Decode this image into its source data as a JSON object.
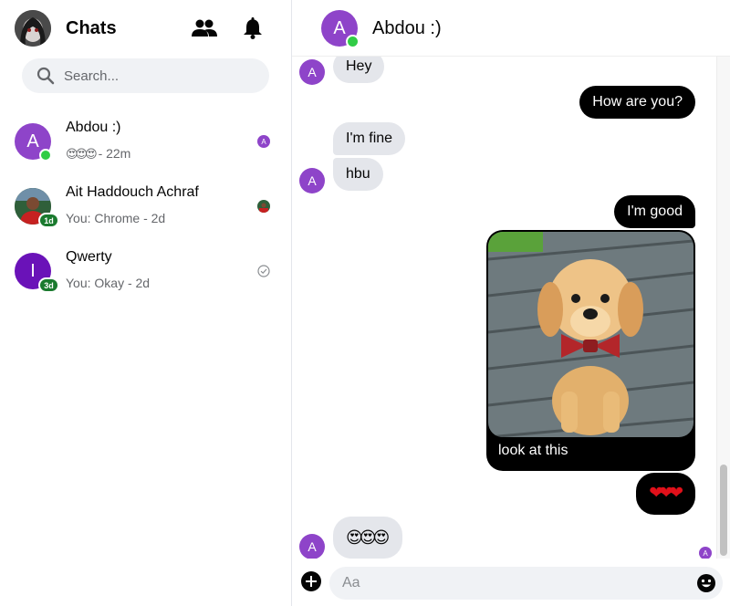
{
  "sidebar": {
    "title": "Chats",
    "search_placeholder": "Search...",
    "chats": [
      {
        "name": "Abdou :)",
        "avatar_letter": "A",
        "sub_emoji": "😍😍😍",
        "sub": "- 22m",
        "avatar_color": "#8e44c9",
        "online": true
      },
      {
        "name": "Ait Haddouch Achraf",
        "avatar_letter": "",
        "sub": "You: Chrome - 2d",
        "badge": "1d"
      },
      {
        "name": "Qwerty",
        "avatar_letter": "I",
        "sub": "You: Okay - 2d",
        "badge": "3d",
        "avatar_color": "#6a12b8"
      }
    ]
  },
  "conversation": {
    "name": "Abdou :)",
    "avatar_letter": "A",
    "messages": [
      {
        "dir": "in",
        "text": "Hey"
      },
      {
        "dir": "out",
        "text": "How are you?"
      },
      {
        "dir": "in",
        "text": "I'm fine"
      },
      {
        "dir": "in",
        "text": "hbu"
      },
      {
        "dir": "out",
        "text": "I'm good"
      },
      {
        "dir": "out",
        "type": "image",
        "caption": "look at this"
      },
      {
        "dir": "out",
        "text": "❤❤❤"
      },
      {
        "dir": "in",
        "text": "😍😍😍"
      }
    ],
    "seen_letter": "A"
  },
  "composer": {
    "placeholder": "Aa"
  },
  "colors": {
    "accent": "#8e44c9",
    "online": "#31cc46",
    "badge": "#1a7a2e",
    "out_bubble": "#000000",
    "in_bubble": "#e4e6eb"
  },
  "icons": [
    "people-icon",
    "bell-icon",
    "search-icon",
    "plus-icon",
    "emoji-icon",
    "check-circle-icon"
  ]
}
